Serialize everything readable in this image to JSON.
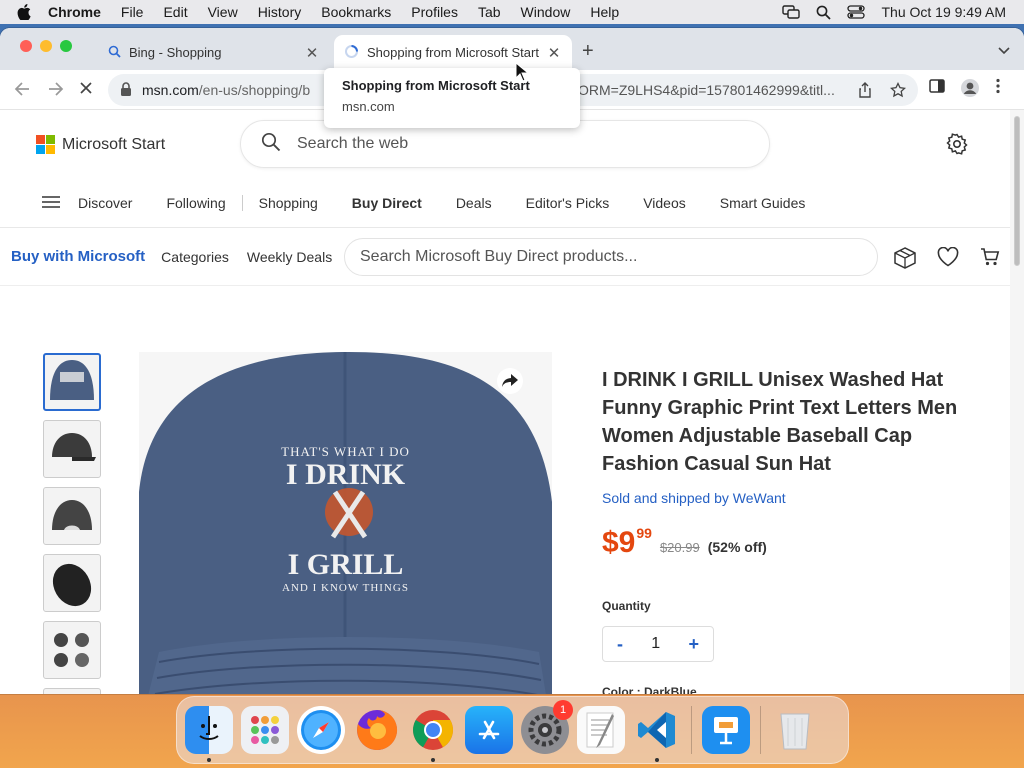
{
  "menubar": {
    "app": "Chrome",
    "items": [
      "File",
      "Edit",
      "View",
      "History",
      "Bookmarks",
      "Profiles",
      "Tab",
      "Window",
      "Help"
    ],
    "clock": "Thu Oct 19  9:49 AM"
  },
  "browser": {
    "tabs": [
      {
        "title": "Bing - Shopping",
        "icon": "search-icon",
        "active": false
      },
      {
        "title": "Shopping from Microsoft Start",
        "icon": "loading-icon",
        "active": true
      }
    ],
    "url_host": "msn.com",
    "url_path": "/en-us/shopping/b",
    "url_tail": "ORM=Z9LHS4&pid=157801462999&titl...",
    "tooltip": {
      "title": "Shopping from Microsoft Start",
      "host": "msn.com"
    }
  },
  "site": {
    "brand": "Microsoft Start",
    "search_placeholder": "Search the web",
    "nav": [
      "Discover",
      "Following",
      "Shopping",
      "Buy Direct",
      "Deals",
      "Editor's Picks",
      "Videos",
      "Smart Guides"
    ],
    "nav_active": "Buy Direct"
  },
  "buy_bar": {
    "title": "Buy with Microsoft",
    "links": [
      "Categories",
      "Weekly Deals"
    ],
    "search_placeholder": "Search Microsoft Buy Direct products..."
  },
  "product": {
    "title": "I DRINK I GRILL Unisex Washed Hat Funny Graphic Print Text Letters Men Women Adjustable Baseball Cap Fashion Casual Sun Hat",
    "seller": "Sold and shipped by WeWant",
    "price_dollars": "$9",
    "price_cents": "99",
    "price_was": "$20.99",
    "discount": "(52% off)",
    "quantity_label": "Quantity",
    "quantity": "1",
    "qty_minus": "-",
    "qty_plus": "+",
    "color_label": "Color : DarkBlue",
    "image_text": {
      "line1": "THAT'S WHAT I DO",
      "line2": "I DRINK",
      "line3": "I GRILL",
      "line4": "AND I KNOW THINGS"
    },
    "hat_color": "#4a5f83",
    "swatch_colors": [
      "#3a3a3a",
      "#6b6b6b",
      "#3e4f74",
      "#4a5a3e",
      "#7a7a7a"
    ]
  },
  "dock": {
    "apps": [
      "Finder",
      "Launchpad",
      "Safari",
      "Firefox",
      "Chrome",
      "App Store",
      "System Settings",
      "TextEdit",
      "Visual Studio Code",
      "Keynote",
      "Trash"
    ],
    "settings_badge": "1"
  },
  "colors": {
    "accent": "#2560c4",
    "price": "#e4470f"
  }
}
